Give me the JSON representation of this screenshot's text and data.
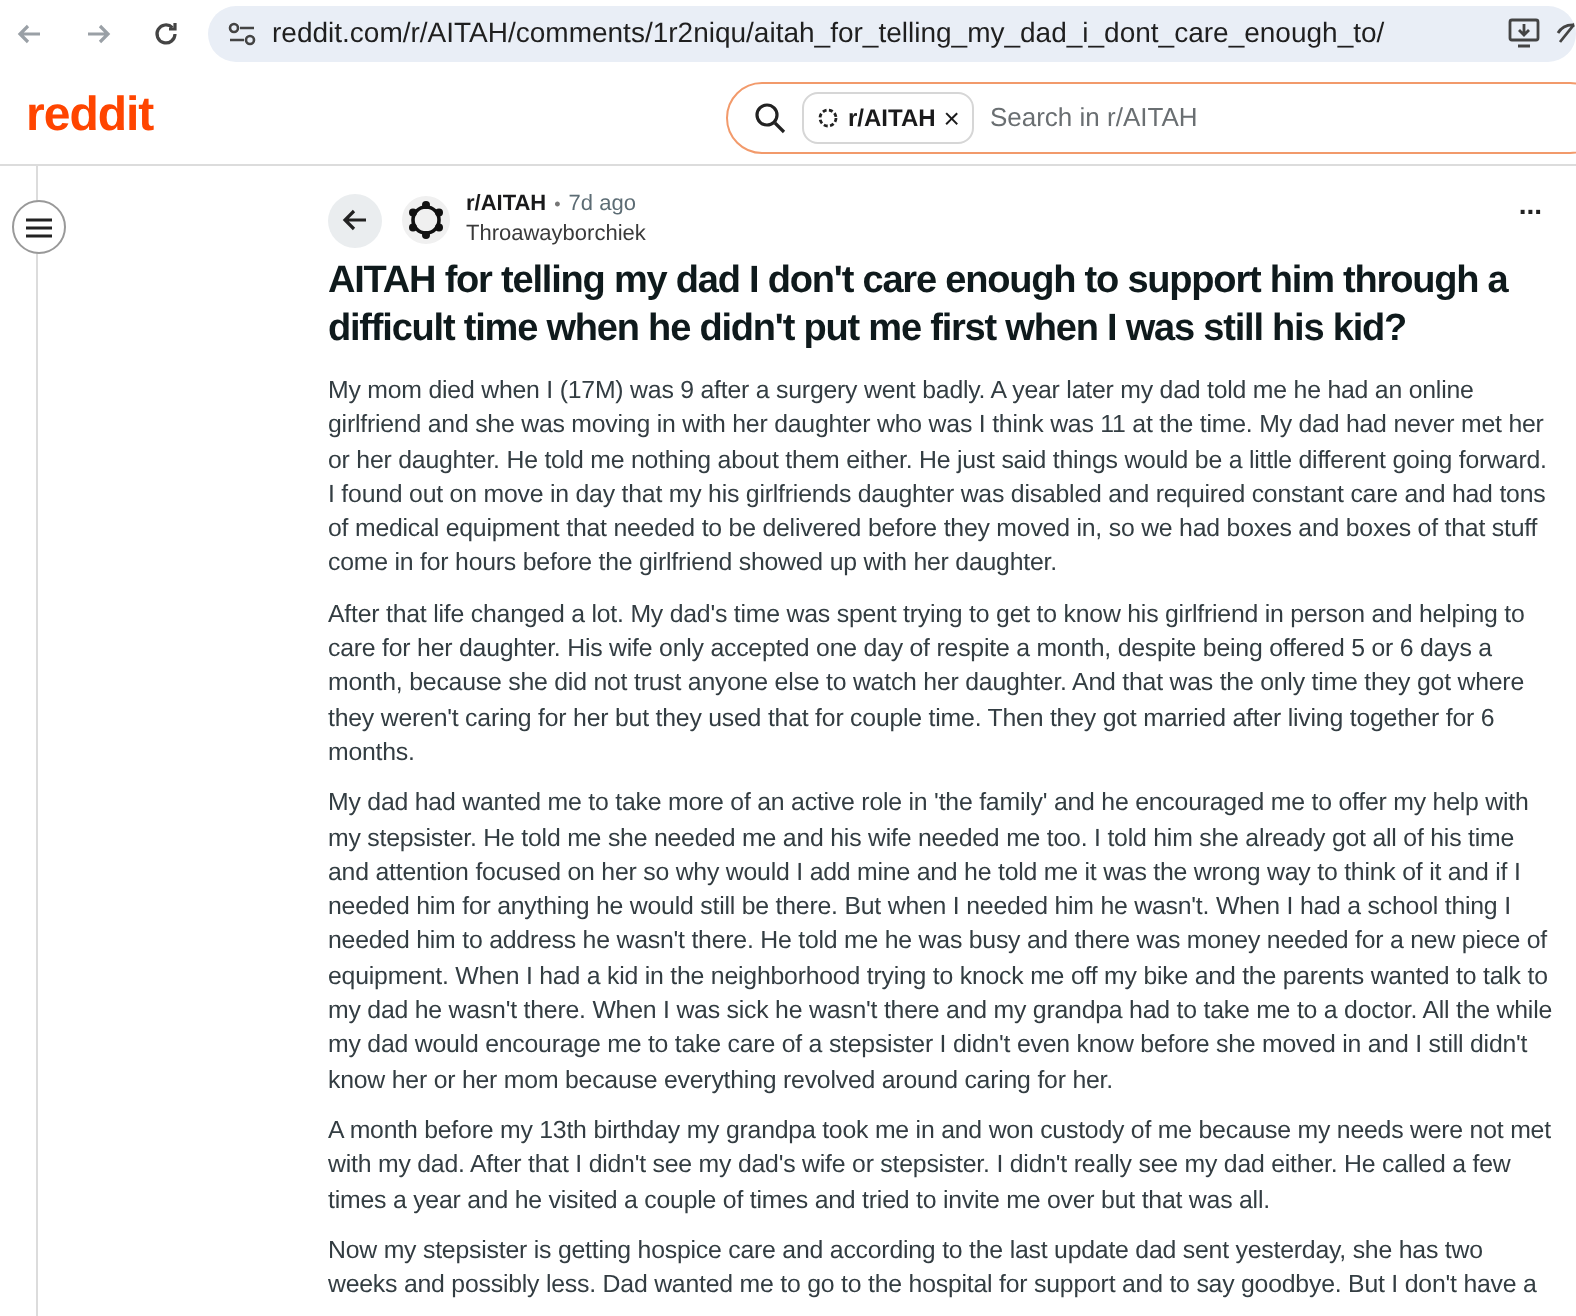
{
  "browser": {
    "url": "reddit.com/r/AITAH/comments/1r2niqu/aitah_for_telling_my_dad_i_dont_care_enough_to/"
  },
  "header": {
    "logo": "reddit",
    "search": {
      "chip": "r/AITAH",
      "chip_close": "×",
      "placeholder": "Search in r/AITAH"
    }
  },
  "post": {
    "subreddit": "r/AITAH",
    "separator": "•",
    "age": "7d ago",
    "author": "Throawayborchiek",
    "menu": "...",
    "title": "AITAH for telling my dad I don't care enough to support him through a difficult time when he didn't put me first when I was still his kid?",
    "paragraphs": [
      "My mom died when I (17M) was 9 after a surgery went badly. A year later my dad told me he had an online girlfriend and she was moving in with her daughter who was I think was 11 at the time. My dad had never met her or her daughter. He told me nothing about them either. He just said things would be a little different going forward. I found out on move in day that my his girlfriends daughter was disabled and required constant care and had tons of medical equipment that needed to be delivered before they moved in, so we had boxes and boxes of that stuff come in for hours before the girlfriend showed up with her daughter.",
      "After that life changed a lot. My dad's time was spent trying to get to know his girlfriend in person and helping to care for her daughter. His wife only accepted one day of respite a month, despite being offered 5 or 6 days a month, because she did not trust anyone else to watch her daughter. And that was the only time they got where they weren't caring for her but they used that for couple time. Then they got married after living together for 6 months.",
      "My dad had wanted me to take more of an active role in 'the family' and he encouraged me to offer my help with my stepsister. He told me she needed me and his wife needed me too. I told him she already got all of his time and attention focused on her so why would I add mine and he told me it was the wrong way to think of it and if I needed him for anything he would still be there. But when I needed him he wasn't. When I had a school thing I needed him to address he wasn't there. He told me he was busy and there was money needed for a new piece of equipment. When I had a kid in the neighborhood trying to knock me off my bike and the parents wanted to talk to my dad he wasn't there. When I was sick he wasn't there and my grandpa had to take me to a doctor. All the while my dad would encourage me to take care of a stepsister I didn't even know before she moved in and I still didn't know her or her mom because everything revolved around caring for her.",
      "A month before my 13th birthday my grandpa took me in and won custody of me because my needs were not met with my dad. After that I didn't see my dad's wife or stepsister. I didn't really see my dad either. He called a few times a year and he visited a couple of times and tried to invite me over but that was all.",
      "Now my stepsister is getting hospice care and according to the last update dad sent yesterday, she has two weeks and possibly less. Dad wanted me to go to the hospital for support and to say goodbye. But I don't have a"
    ]
  }
}
